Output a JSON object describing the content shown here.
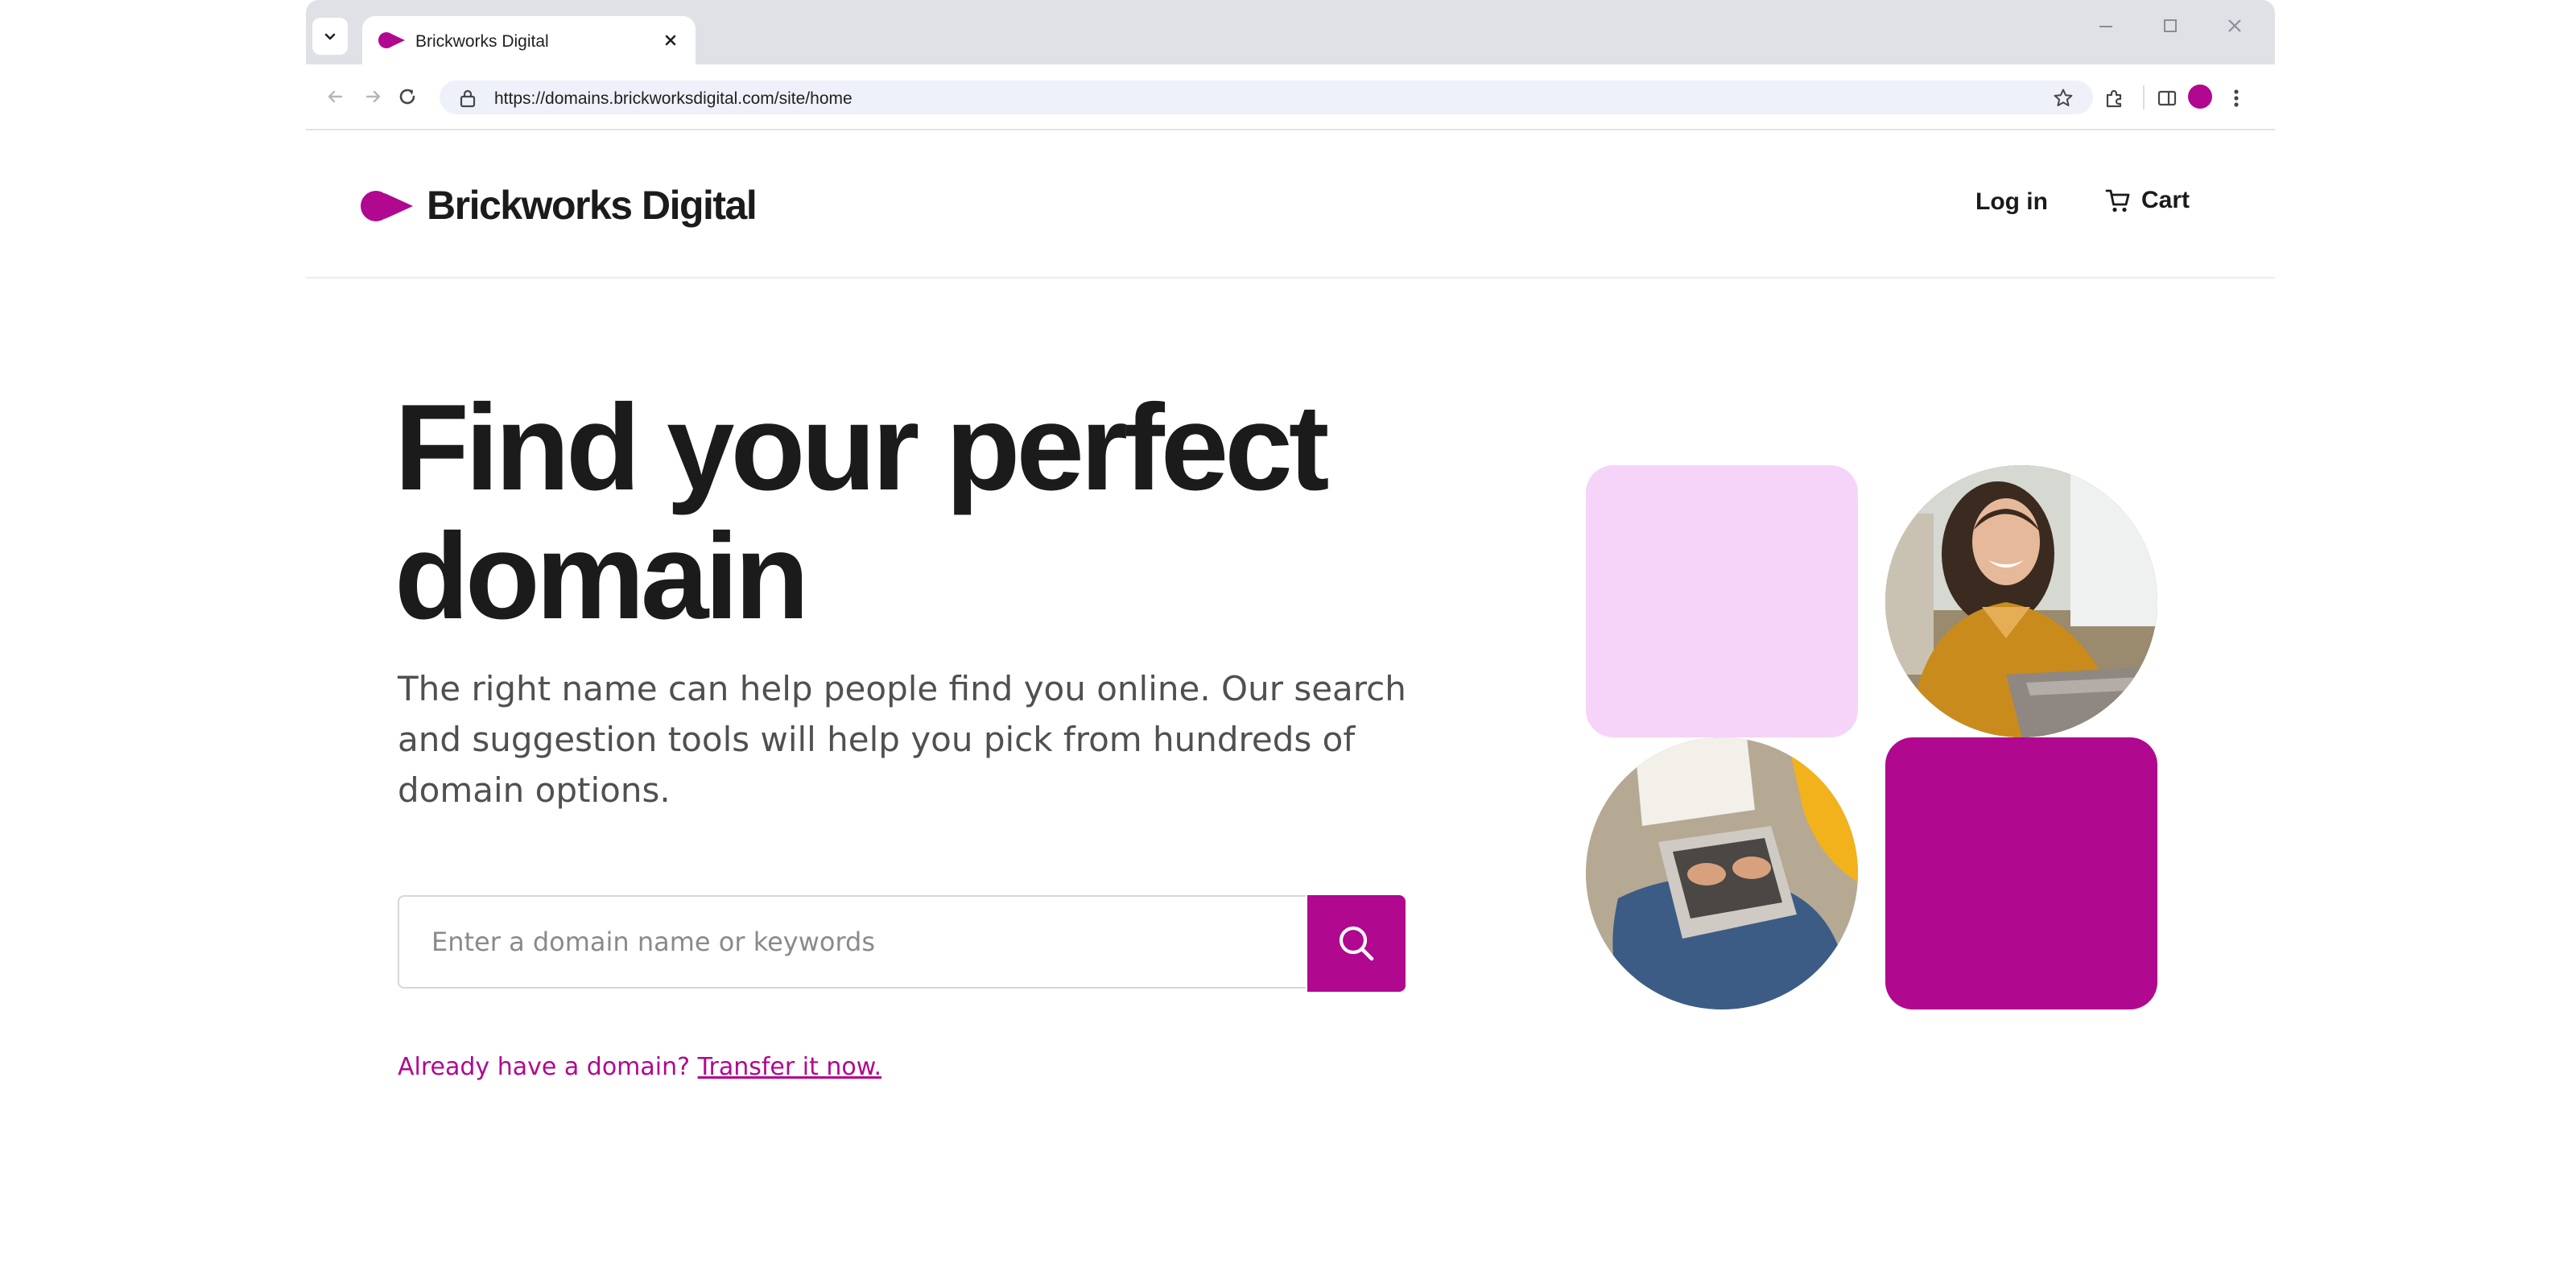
{
  "browser": {
    "tab_title": "Brickworks Digital",
    "url": "https://domains.brickworksdigital.com/site/home"
  },
  "header": {
    "brand_name": "Brickworks Digital",
    "login_label": "Log in",
    "cart_label": "Cart"
  },
  "hero": {
    "title": "Find your perfect domain",
    "description": "The right name can help people find you online. Our search and suggestion tools will help you pick from hundreds of domain options.",
    "search_placeholder": "Enter a domain name or keywords",
    "transfer_prompt": "Already have a domain?",
    "transfer_link": "Transfer it now."
  },
  "colors": {
    "brand": "#b0088f",
    "tile_pink": "#f6d3f9",
    "text_dark": "#1b1b1b"
  },
  "icons": {
    "tab_search": "chevron-down-icon",
    "tab_close": "close-icon",
    "search": "search-icon",
    "cart": "cart-icon",
    "lock": "lock-icon",
    "bookmark": "star-icon",
    "extensions": "puzzle-icon",
    "side_panel": "side-panel-icon",
    "menu": "kebab-menu-icon"
  }
}
